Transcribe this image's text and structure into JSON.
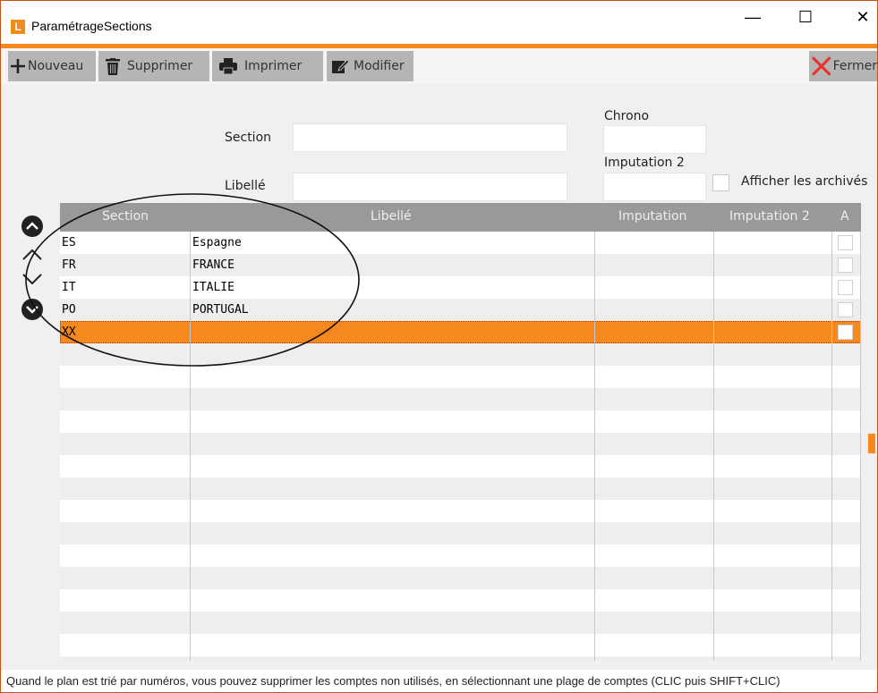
{
  "window": {
    "title": "ParamétrageSections",
    "app_icon_letter": "L",
    "minimize": "—",
    "maximize": "☐",
    "close": "✕"
  },
  "toolbar": {
    "nouveau": "Nouveau",
    "supprimer": "Supprimer",
    "imprimer": "Imprimer",
    "modifier": "Modifier",
    "fermer": "Fermer"
  },
  "form": {
    "section_label": "Section",
    "section_value": "",
    "libelle_label": "Libellé",
    "libelle_value": "",
    "chrono_label": "Chrono",
    "chrono_value": "",
    "imputation2_label": "Imputation 2",
    "imputation2_value": "",
    "archives_label": "Afficher les archivés",
    "archives_checked": false
  },
  "grid": {
    "columns": [
      "Section",
      "Libellé",
      "Imputation",
      "Imputation 2",
      "A"
    ],
    "rows": [
      {
        "section": "ES",
        "libelle": "Espagne",
        "imputation": "",
        "imputation2": ""
      },
      {
        "section": "FR",
        "libelle": "FRANCE",
        "imputation": "",
        "imputation2": ""
      },
      {
        "section": "IT",
        "libelle": "ITALIE",
        "imputation": "",
        "imputation2": ""
      },
      {
        "section": "PO",
        "libelle": "PORTUGAL",
        "imputation": "",
        "imputation2": ""
      },
      {
        "section": "XX",
        "libelle": "",
        "imputation": "",
        "imputation2": ""
      }
    ],
    "selected_row": 4
  },
  "status": "Quand le plan est trié par numéros, vous pouvez supprimer les comptes non utilisés, en sélectionnant une plage de comptes (CLIC puis SHIFT+CLIC)",
  "colors": {
    "accent": "#f5891f",
    "header_bg": "#999999",
    "toolbar_btn": "#b5b5b5"
  }
}
